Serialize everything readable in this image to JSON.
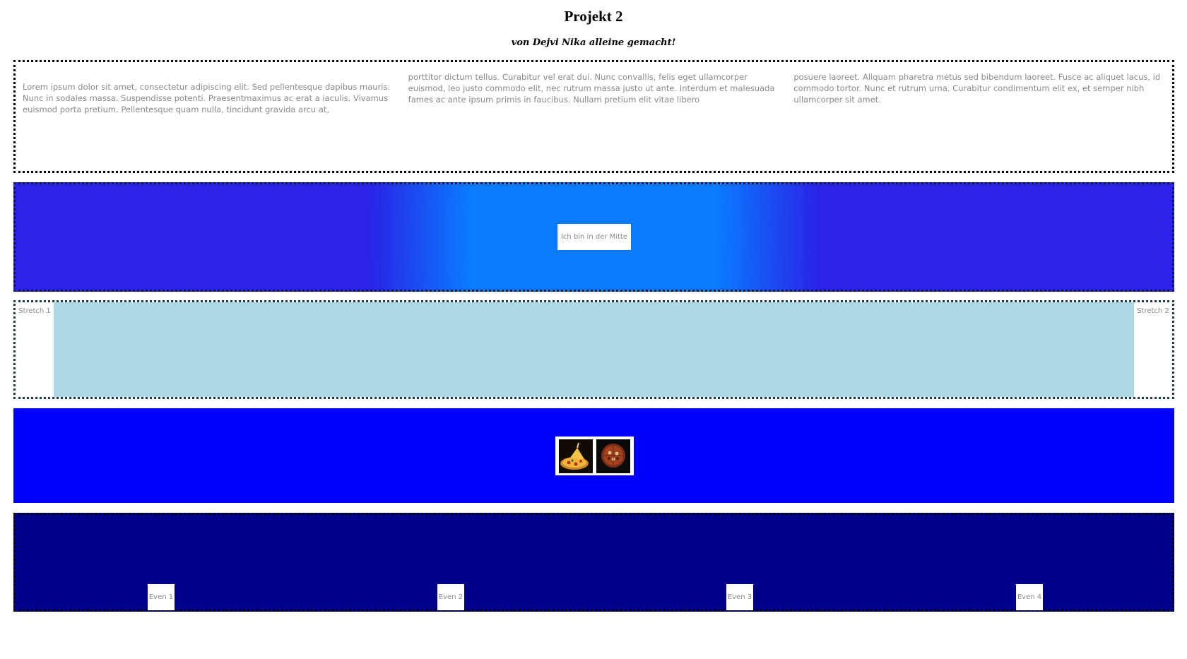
{
  "header": {
    "title": "Projekt 2",
    "subtitle": "von Dejvi Nika alleine gemacht!"
  },
  "columns": {
    "col1": "Lorem ipsum dolor sit amet, consectetur adipiscing elit. Sed pellentesque dapibus mauris. Nunc in sodales massa. Suspendisse potenti. Praesentmaximus ac erat a iaculis. Vivamus euismod porta pretium. Pellentesque quam nulla, tincidunt gravida arcu at,",
    "col2": "porttitor dictum tellus. Curabitur vel erat dui. Nunc convallis, felis eget ullamcorper euismod, leo justo commodo elit, nec rutrum massa justo ut ante. Interdum et malesuada fames ac ante ipsum primis in faucibus. Nullam pretium elit vitae libero",
    "col3": "posuere laoreet. Aliquam pharetra metus sed bibendum laoreet. Fusce ac aliquet lacus, id commodo tortor. Nunc et rutrum urna. Curabitur condimentum elit ex, et semper nibh ullamcorper sit amet."
  },
  "center": {
    "label": "Ich bin in der Mitte"
  },
  "stretch": {
    "item1": "Stretch 1",
    "item2": "Stretch 2"
  },
  "images": {
    "items": [
      {
        "icon": "pizza-slice-image"
      },
      {
        "icon": "pizza-whole-image"
      }
    ]
  },
  "even": {
    "items": [
      "Even 1",
      "Even 2",
      "Even 3",
      "Even 4"
    ]
  },
  "colors": {
    "center_gradient_inner": "#0a7bff",
    "center_gradient_outer": "#2a22e6",
    "stretch_fill": "#add8e6",
    "images_bg": "#0000ff",
    "even_bg": "#00008b",
    "text_gray": "#8a8a8a"
  }
}
